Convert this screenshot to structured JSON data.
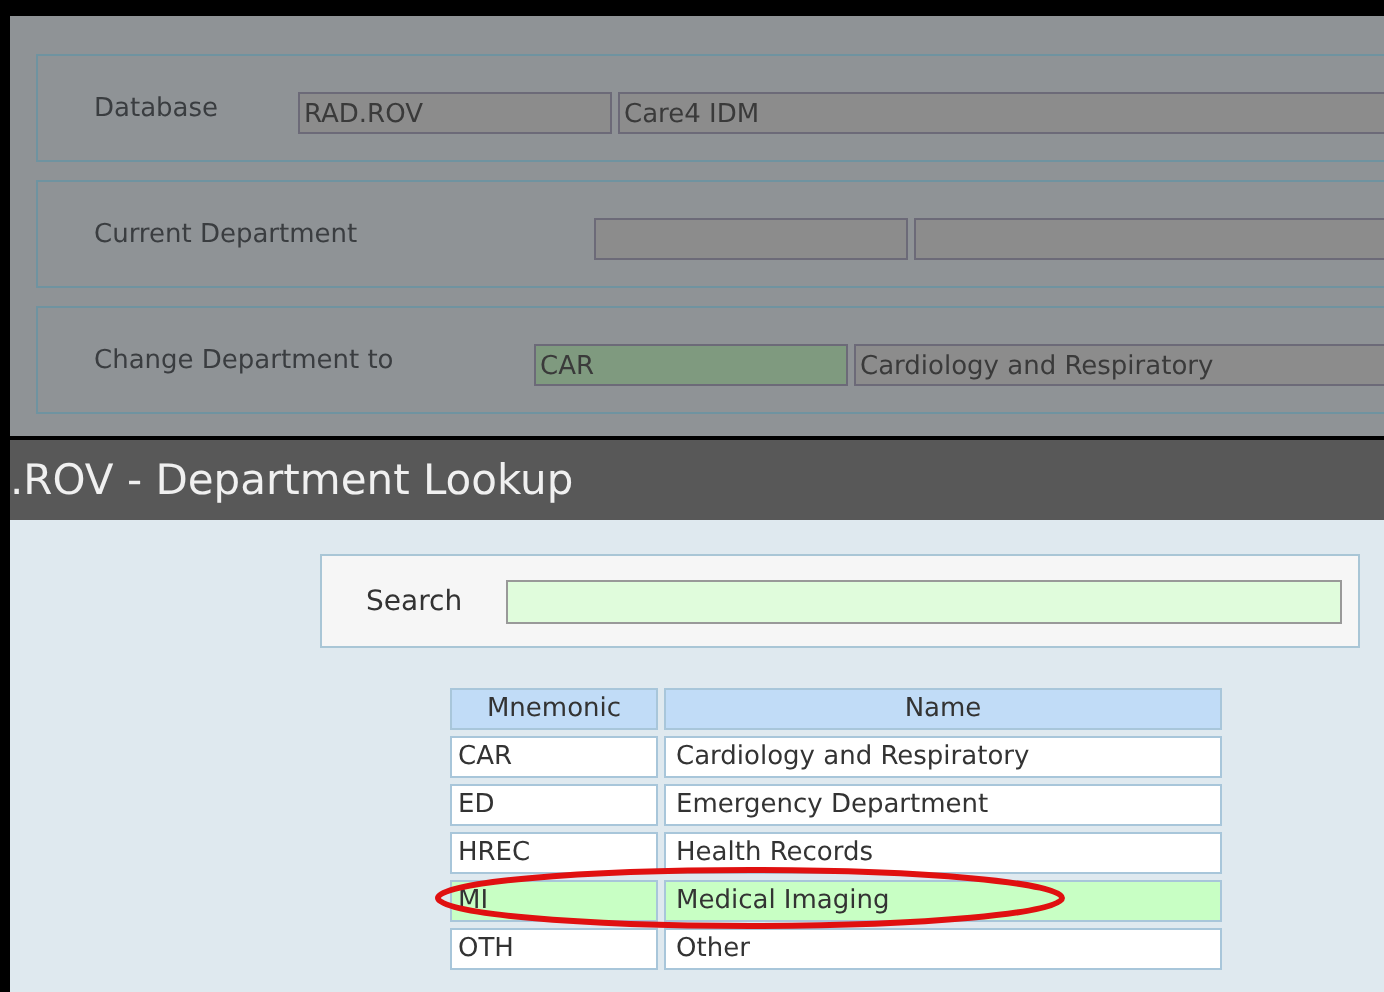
{
  "form": {
    "fields": [
      {
        "label": "Database",
        "code": "RAD.ROV",
        "name": "Care4 IDM",
        "highlighted": false
      },
      {
        "label": "Current Department",
        "highlighted": false
      },
      {
        "label": "Change Department to",
        "code": "CAR",
        "name": "Cardiology and Respiratory",
        "highlighted": true
      }
    ]
  },
  "dialog": {
    "title": ".ROV - Department Lookup",
    "search": {
      "label": "Search"
    },
    "table": {
      "columns": [
        "Mnemonic",
        "Name"
      ],
      "rows": [
        {
          "cells": [
            "CAR",
            "Cardiology and Respiratory"
          ],
          "selected": false
        },
        {
          "cells": [
            "ED",
            "Emergency Department"
          ],
          "selected": false
        },
        {
          "cells": [
            "HREC",
            "Health Records"
          ],
          "selected": false
        },
        {
          "cells": [
            "MI",
            "Medical Imaging"
          ],
          "selected": true
        },
        {
          "cells": [
            "OTH",
            "Other"
          ],
          "selected": false
        }
      ]
    }
  },
  "annotation": {
    "kind": "ellipse",
    "color": "#e01010"
  }
}
